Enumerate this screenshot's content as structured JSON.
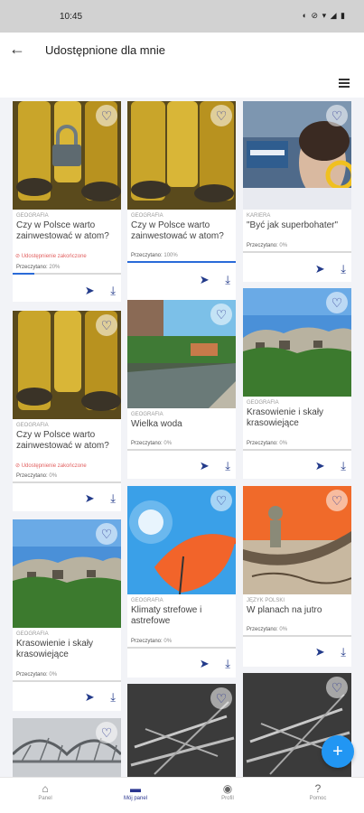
{
  "statusbar": {
    "time": "10:45",
    "icons": "◐ ⊘ ▾ ◢ ▮"
  },
  "header": {
    "back_icon": "←",
    "title": "Udostępnione dla mnie",
    "view_icon": "list-view-icon"
  },
  "cards": [
    {
      "category": "GEOGRAFIA",
      "title": "Czy w Polsce warto zainwestować w atom?",
      "warning": "Udostępnienie zakończone",
      "read_label": "Przeczytano:",
      "read_pct": "20%",
      "progress": 0.2,
      "liked": false,
      "image": "nuclear-barrels-lock"
    },
    {
      "category": "GEOGRAFIA",
      "title": "Czy w Polsce warto zainwestować w atom?",
      "read_label": "Przeczytano:",
      "read_pct": "100%",
      "progress": 1.0,
      "liked": false,
      "image": "nuclear-barrels"
    },
    {
      "category": "KARIERA",
      "title": "\"Być jak superbohater\"",
      "read_label": "Przeczytano:",
      "read_pct": "0%",
      "progress": 0,
      "liked": false,
      "image": "superhero-photo"
    },
    {
      "category": "GEOGRAFIA",
      "title": "Czy w Polsce warto zainwestować w atom?",
      "warning": "Udostępnienie zakończone",
      "read_label": "Przeczytano:",
      "read_pct": "0%",
      "progress": 0,
      "liked": false,
      "image": "nuclear-barrels"
    },
    {
      "category": "GEOGRAFIA",
      "title": "Wielka woda",
      "read_label": "Przeczytano:",
      "read_pct": "0%",
      "progress": 0,
      "liked": false,
      "image": "flooded-river"
    },
    {
      "category": "GEOGRAFIA",
      "title": "Krasowienie i skały krasowiejące",
      "read_label": "Przeczytano:",
      "read_pct": "0%",
      "progress": 0,
      "liked": false,
      "image": "karst-rocks"
    },
    {
      "category": "GEOGRAFIA",
      "title": "Krasowienie i skały krasowiejące",
      "read_label": "Przeczytano:",
      "read_pct": "0%",
      "progress": 0,
      "liked": false,
      "image": "karst-rocks"
    },
    {
      "category": "GEOGRAFIA",
      "title": "Klimaty strefowe i astrefowe",
      "read_label": "Przeczytano:",
      "read_pct": "0%",
      "progress": 0,
      "liked": false,
      "image": "umbrella-sun"
    },
    {
      "category": "JĘZYK POLSKI",
      "title": "W planach na jutro",
      "read_label": "Przeczytano:",
      "read_pct": "0%",
      "progress": 0,
      "liked": false,
      "image": "ship-illustration"
    }
  ],
  "partial_cards": [
    {
      "image": "bridge"
    },
    {
      "image": "rockets"
    },
    {
      "image": "rockets"
    }
  ],
  "actions": {
    "share_icon": "➤",
    "download_icon": "⤓",
    "heart_icon": "♡"
  },
  "fab": {
    "label": "+"
  },
  "nav": [
    {
      "label": "Panel",
      "icon": "home-icon",
      "glyph": "⌂",
      "active": false
    },
    {
      "label": "Mój panel",
      "icon": "folder-icon",
      "glyph": "▬",
      "active": true
    },
    {
      "label": "Profil",
      "icon": "profile-icon",
      "glyph": "◉",
      "active": false
    },
    {
      "label": "Pomoc",
      "icon": "help-icon",
      "glyph": "?",
      "active": false
    }
  ],
  "colors": {
    "accent": "#2a3590",
    "fab": "#2196f3",
    "progress": "#2a6ad8",
    "warning": "#e26060"
  }
}
